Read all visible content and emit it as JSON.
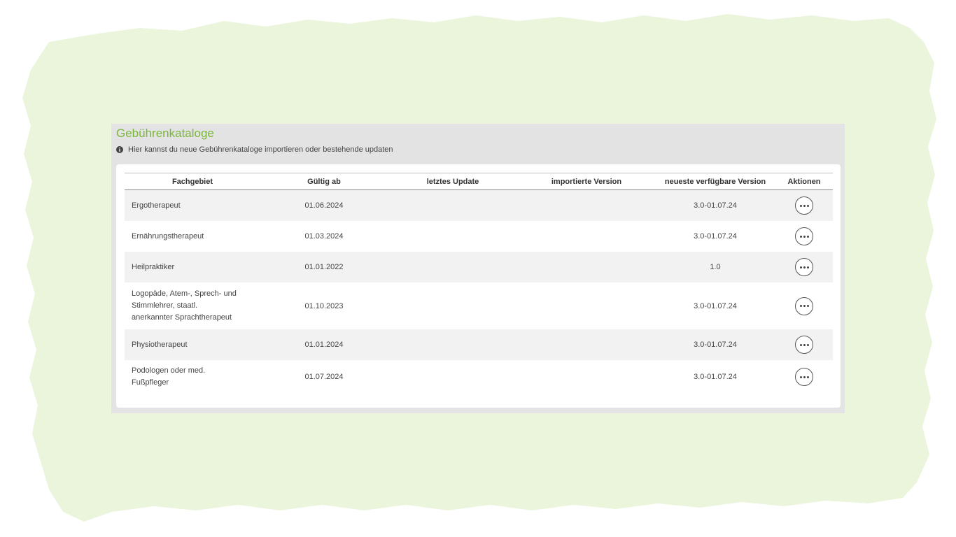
{
  "panel": {
    "title": "Gebührenkataloge",
    "hint": "Hier kannst du neue Gebührenkataloge importieren oder bestehende updaten",
    "hint_icon": "info-circle-icon"
  },
  "colors": {
    "accent": "#7bb83a",
    "background_blob": "#eaf5dc",
    "panel_bg": "#e3e3e3"
  },
  "table": {
    "headers": {
      "fachgebiet": "Fachgebiet",
      "gueltig_ab": "Gültig ab",
      "letztes_update": "letztes Update",
      "importierte_version": "importierte Version",
      "neueste_version": "neueste verfügbare Version",
      "aktionen": "Aktionen"
    },
    "rows": [
      {
        "fachgebiet": [
          "Ergotherapeut"
        ],
        "gueltig_ab": "01.06.2024",
        "letztes_update": "",
        "importierte_version": "",
        "neueste_version": "3.0-01.07.24",
        "action_icon": "more-horizontal-icon"
      },
      {
        "fachgebiet": [
          "Ernährungstherapeut"
        ],
        "gueltig_ab": "01.03.2024",
        "letztes_update": "",
        "importierte_version": "",
        "neueste_version": "3.0-01.07.24",
        "action_icon": "more-horizontal-icon"
      },
      {
        "fachgebiet": [
          "Heilpraktiker"
        ],
        "gueltig_ab": "01.01.2022",
        "letztes_update": "",
        "importierte_version": "",
        "neueste_version": "1.0",
        "action_icon": "more-horizontal-icon"
      },
      {
        "fachgebiet": [
          "Logopäde, Atem-, Sprech- und",
          "Stimmlehrer, staatl.",
          "anerkannter Sprachtherapeut"
        ],
        "gueltig_ab": "01.10.2023",
        "letztes_update": "",
        "importierte_version": "",
        "neueste_version": "3.0-01.07.24",
        "action_icon": "more-horizontal-icon"
      },
      {
        "fachgebiet": [
          "Physiotherapeut"
        ],
        "gueltig_ab": "01.01.2024",
        "letztes_update": "",
        "importierte_version": "",
        "neueste_version": "3.0-01.07.24",
        "action_icon": "more-horizontal-icon"
      },
      {
        "fachgebiet": [
          "Podologen oder med.",
          "Fußpfleger"
        ],
        "gueltig_ab": "01.07.2024",
        "letztes_update": "",
        "importierte_version": "",
        "neueste_version": "3.0-01.07.24",
        "action_icon": "more-horizontal-icon"
      }
    ]
  }
}
